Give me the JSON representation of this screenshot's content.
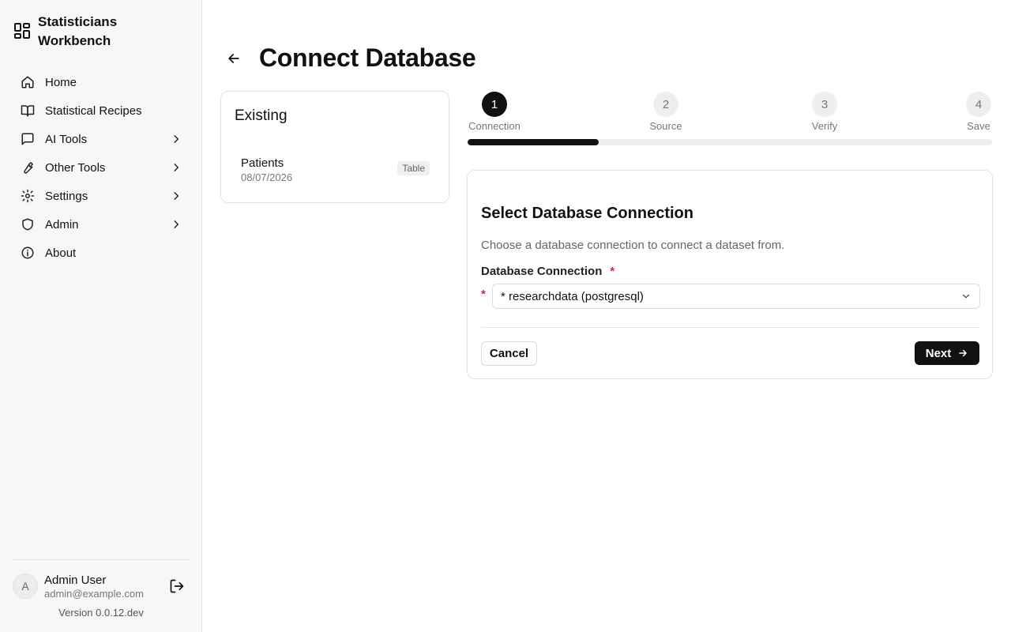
{
  "app": {
    "title": "Statisticians Workbench"
  },
  "sidebar": {
    "items": [
      {
        "label": "Home",
        "icon": "home-icon",
        "has_submenu": false
      },
      {
        "label": "Statistical Recipes",
        "icon": "book-icon",
        "has_submenu": false
      },
      {
        "label": "AI Tools",
        "icon": "chat-icon",
        "has_submenu": true
      },
      {
        "label": "Other Tools",
        "icon": "wrench-icon",
        "has_submenu": true
      },
      {
        "label": "Settings",
        "icon": "gear-icon",
        "has_submenu": true
      },
      {
        "label": "Admin",
        "icon": "shield-icon",
        "has_submenu": true
      },
      {
        "label": "About",
        "icon": "info-icon",
        "has_submenu": false
      }
    ]
  },
  "user": {
    "initial": "A",
    "name": "Admin User",
    "email": "admin@example.com"
  },
  "version": "Version 0.0.12.dev",
  "page": {
    "title": "Connect Database"
  },
  "existing": {
    "title": "Existing",
    "items": [
      {
        "name": "Patients",
        "date": "08/07/2026",
        "type": "Table"
      }
    ]
  },
  "stepper": {
    "current_step": 1,
    "progress_fraction": 0.25,
    "steps": [
      {
        "number": "1",
        "label": "Connection"
      },
      {
        "number": "2",
        "label": "Source"
      },
      {
        "number": "3",
        "label": "Verify"
      },
      {
        "number": "4",
        "label": "Save"
      }
    ]
  },
  "form": {
    "title": "Select Database Connection",
    "description": "Choose a database connection to connect a dataset from.",
    "field_label": "Database Connection",
    "required_mark": "*",
    "selected_value": "* researchdata (postgresql)",
    "cancel_label": "Cancel",
    "next_label": "Next"
  },
  "colors": {
    "accent": "#111111",
    "required": "#e11d48",
    "sidebar_bg": "#f7f7f7"
  }
}
